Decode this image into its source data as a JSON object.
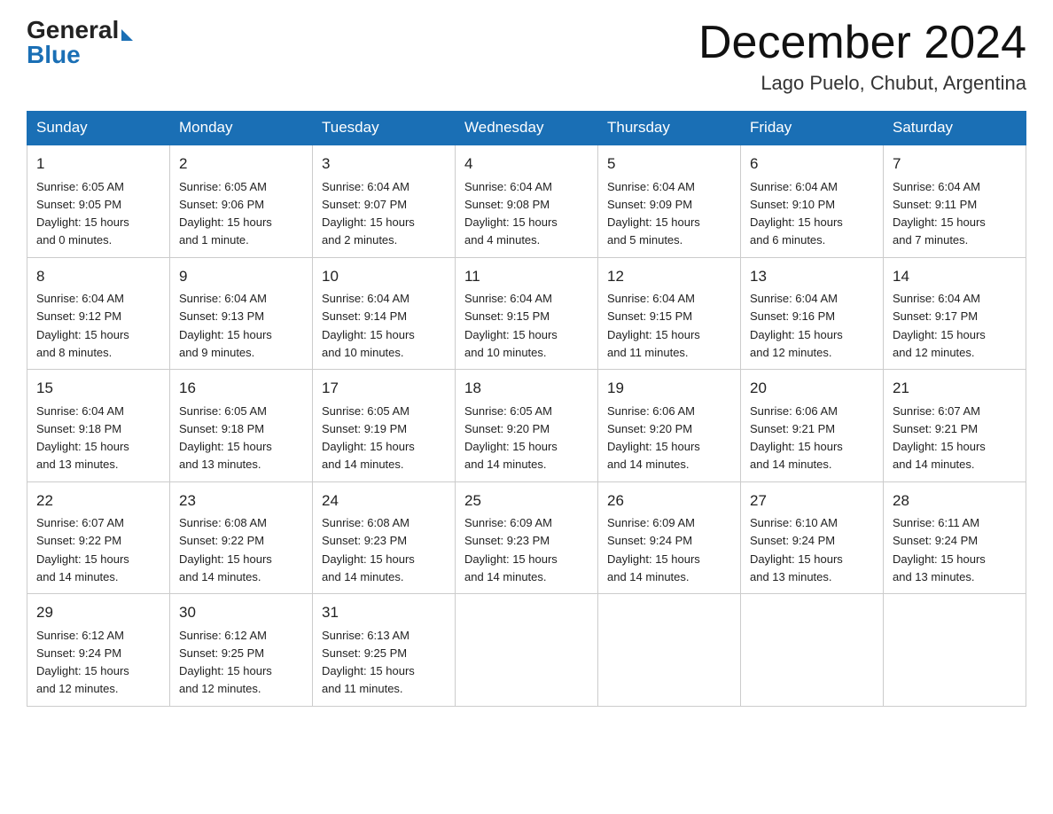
{
  "logo": {
    "text_general": "General",
    "text_blue": "Blue",
    "line2_blue": "Blue"
  },
  "title": "December 2024",
  "subtitle": "Lago Puelo, Chubut, Argentina",
  "days_of_week": [
    "Sunday",
    "Monday",
    "Tuesday",
    "Wednesday",
    "Thursday",
    "Friday",
    "Saturday"
  ],
  "weeks": [
    [
      {
        "day": "1",
        "sunrise": "6:05 AM",
        "sunset": "9:05 PM",
        "daylight_hours": "15",
        "daylight_minutes": "0",
        "minute_word": "minutes"
      },
      {
        "day": "2",
        "sunrise": "6:05 AM",
        "sunset": "9:06 PM",
        "daylight_hours": "15",
        "daylight_minutes": "1",
        "minute_word": "minute"
      },
      {
        "day": "3",
        "sunrise": "6:04 AM",
        "sunset": "9:07 PM",
        "daylight_hours": "15",
        "daylight_minutes": "2",
        "minute_word": "minutes"
      },
      {
        "day": "4",
        "sunrise": "6:04 AM",
        "sunset": "9:08 PM",
        "daylight_hours": "15",
        "daylight_minutes": "4",
        "minute_word": "minutes"
      },
      {
        "day": "5",
        "sunrise": "6:04 AM",
        "sunset": "9:09 PM",
        "daylight_hours": "15",
        "daylight_minutes": "5",
        "minute_word": "minutes"
      },
      {
        "day": "6",
        "sunrise": "6:04 AM",
        "sunset": "9:10 PM",
        "daylight_hours": "15",
        "daylight_minutes": "6",
        "minute_word": "minutes"
      },
      {
        "day": "7",
        "sunrise": "6:04 AM",
        "sunset": "9:11 PM",
        "daylight_hours": "15",
        "daylight_minutes": "7",
        "minute_word": "minutes"
      }
    ],
    [
      {
        "day": "8",
        "sunrise": "6:04 AM",
        "sunset": "9:12 PM",
        "daylight_hours": "15",
        "daylight_minutes": "8",
        "minute_word": "minutes"
      },
      {
        "day": "9",
        "sunrise": "6:04 AM",
        "sunset": "9:13 PM",
        "daylight_hours": "15",
        "daylight_minutes": "9",
        "minute_word": "minutes"
      },
      {
        "day": "10",
        "sunrise": "6:04 AM",
        "sunset": "9:14 PM",
        "daylight_hours": "15",
        "daylight_minutes": "10",
        "minute_word": "minutes"
      },
      {
        "day": "11",
        "sunrise": "6:04 AM",
        "sunset": "9:15 PM",
        "daylight_hours": "15",
        "daylight_minutes": "10",
        "minute_word": "minutes"
      },
      {
        "day": "12",
        "sunrise": "6:04 AM",
        "sunset": "9:15 PM",
        "daylight_hours": "15",
        "daylight_minutes": "11",
        "minute_word": "minutes"
      },
      {
        "day": "13",
        "sunrise": "6:04 AM",
        "sunset": "9:16 PM",
        "daylight_hours": "15",
        "daylight_minutes": "12",
        "minute_word": "minutes"
      },
      {
        "day": "14",
        "sunrise": "6:04 AM",
        "sunset": "9:17 PM",
        "daylight_hours": "15",
        "daylight_minutes": "12",
        "minute_word": "minutes"
      }
    ],
    [
      {
        "day": "15",
        "sunrise": "6:04 AM",
        "sunset": "9:18 PM",
        "daylight_hours": "15",
        "daylight_minutes": "13",
        "minute_word": "minutes"
      },
      {
        "day": "16",
        "sunrise": "6:05 AM",
        "sunset": "9:18 PM",
        "daylight_hours": "15",
        "daylight_minutes": "13",
        "minute_word": "minutes"
      },
      {
        "day": "17",
        "sunrise": "6:05 AM",
        "sunset": "9:19 PM",
        "daylight_hours": "15",
        "daylight_minutes": "14",
        "minute_word": "minutes"
      },
      {
        "day": "18",
        "sunrise": "6:05 AM",
        "sunset": "9:20 PM",
        "daylight_hours": "15",
        "daylight_minutes": "14",
        "minute_word": "minutes"
      },
      {
        "day": "19",
        "sunrise": "6:06 AM",
        "sunset": "9:20 PM",
        "daylight_hours": "15",
        "daylight_minutes": "14",
        "minute_word": "minutes"
      },
      {
        "day": "20",
        "sunrise": "6:06 AM",
        "sunset": "9:21 PM",
        "daylight_hours": "15",
        "daylight_minutes": "14",
        "minute_word": "minutes"
      },
      {
        "day": "21",
        "sunrise": "6:07 AM",
        "sunset": "9:21 PM",
        "daylight_hours": "15",
        "daylight_minutes": "14",
        "minute_word": "minutes"
      }
    ],
    [
      {
        "day": "22",
        "sunrise": "6:07 AM",
        "sunset": "9:22 PM",
        "daylight_hours": "15",
        "daylight_minutes": "14",
        "minute_word": "minutes"
      },
      {
        "day": "23",
        "sunrise": "6:08 AM",
        "sunset": "9:22 PM",
        "daylight_hours": "15",
        "daylight_minutes": "14",
        "minute_word": "minutes"
      },
      {
        "day": "24",
        "sunrise": "6:08 AM",
        "sunset": "9:23 PM",
        "daylight_hours": "15",
        "daylight_minutes": "14",
        "minute_word": "minutes"
      },
      {
        "day": "25",
        "sunrise": "6:09 AM",
        "sunset": "9:23 PM",
        "daylight_hours": "15",
        "daylight_minutes": "14",
        "minute_word": "minutes"
      },
      {
        "day": "26",
        "sunrise": "6:09 AM",
        "sunset": "9:24 PM",
        "daylight_hours": "15",
        "daylight_minutes": "14",
        "minute_word": "minutes"
      },
      {
        "day": "27",
        "sunrise": "6:10 AM",
        "sunset": "9:24 PM",
        "daylight_hours": "15",
        "daylight_minutes": "13",
        "minute_word": "minutes"
      },
      {
        "day": "28",
        "sunrise": "6:11 AM",
        "sunset": "9:24 PM",
        "daylight_hours": "15",
        "daylight_minutes": "13",
        "minute_word": "minutes"
      }
    ],
    [
      {
        "day": "29",
        "sunrise": "6:12 AM",
        "sunset": "9:24 PM",
        "daylight_hours": "15",
        "daylight_minutes": "12",
        "minute_word": "minutes"
      },
      {
        "day": "30",
        "sunrise": "6:12 AM",
        "sunset": "9:25 PM",
        "daylight_hours": "15",
        "daylight_minutes": "12",
        "minute_word": "minutes"
      },
      {
        "day": "31",
        "sunrise": "6:13 AM",
        "sunset": "9:25 PM",
        "daylight_hours": "15",
        "daylight_minutes": "11",
        "minute_word": "minutes"
      },
      null,
      null,
      null,
      null
    ]
  ]
}
